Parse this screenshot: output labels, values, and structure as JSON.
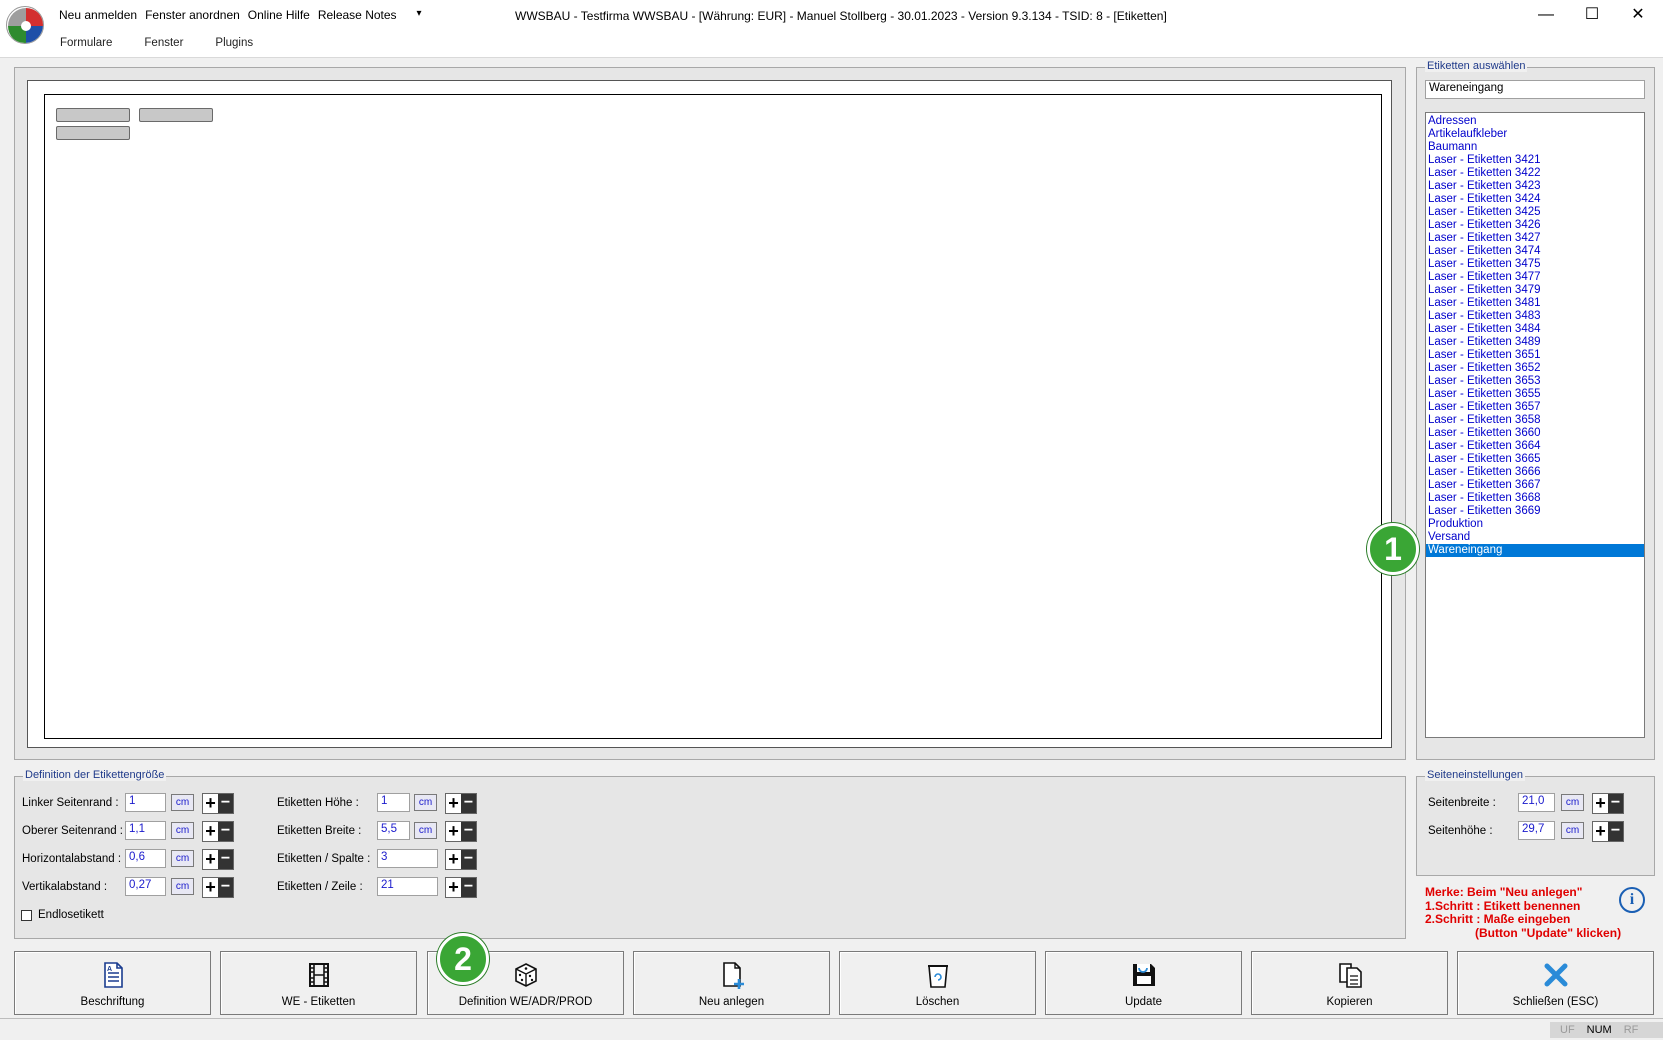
{
  "titlebar": {
    "title": "WWSBAU - Testfirma WWSBAU - [Währung: EUR] - Manuel Stollberg - 30.01.2023 - Version 9.3.134  - TSID: 8  - [Etiketten]",
    "menu": [
      "Neu anmelden",
      "Fenster anordnen",
      "Online Hilfe",
      "Release Notes"
    ],
    "dropdown_glyph": "▾",
    "submenu": [
      "Formulare",
      "Fenster",
      "Plugins"
    ],
    "minimize": "—",
    "maximize": "☐",
    "close": "✕"
  },
  "preview": {
    "label_boxes": 3
  },
  "label_select": {
    "group_title": "Etiketten auswählen",
    "current_value": "Wareneingang",
    "items": [
      "Adressen",
      "Artikelaufkleber",
      "Baumann",
      "Laser - Etiketten 3421",
      "Laser - Etiketten 3422",
      "Laser - Etiketten 3423",
      "Laser - Etiketten 3424",
      "Laser - Etiketten 3425",
      "Laser - Etiketten 3426",
      "Laser - Etiketten 3427",
      "Laser - Etiketten 3474",
      "Laser - Etiketten 3475",
      "Laser - Etiketten 3477",
      "Laser - Etiketten 3479",
      "Laser - Etiketten 3481",
      "Laser - Etiketten 3483",
      "Laser - Etiketten 3484",
      "Laser - Etiketten 3489",
      "Laser - Etiketten 3651",
      "Laser - Etiketten 3652",
      "Laser - Etiketten 3653",
      "Laser - Etiketten 3655",
      "Laser - Etiketten 3657",
      "Laser - Etiketten 3658",
      "Laser - Etiketten 3660",
      "Laser - Etiketten 3664",
      "Laser - Etiketten 3665",
      "Laser - Etiketten 3666",
      "Laser - Etiketten 3667",
      "Laser - Etiketten 3668",
      "Laser - Etiketten 3669",
      "Produktion",
      "Versand",
      "Wareneingang"
    ],
    "selected": "Wareneingang"
  },
  "size_definition": {
    "group_title": "Definition der Etikettengröße",
    "left_fields": [
      {
        "label": "Linker Seitenrand :",
        "value": "1",
        "unit": "cm"
      },
      {
        "label": "Oberer Seitenrand :",
        "value": "1,1",
        "unit": "cm"
      },
      {
        "label": "Horizontalabstand :",
        "value": "0,6",
        "unit": "cm"
      },
      {
        "label": "Vertikalabstand :",
        "value": "0,27",
        "unit": "cm"
      }
    ],
    "right_fields": [
      {
        "label": "Etiketten Höhe :",
        "value": "1",
        "unit": "cm"
      },
      {
        "label": "Etiketten Breite :",
        "value": "5,5",
        "unit": "cm"
      },
      {
        "label": "Etiketten / Spalte :",
        "value": "3"
      },
      {
        "label": "Etiketten / Zeile :",
        "value": "21"
      }
    ],
    "endless_label": "Endlosetikett",
    "endless_checked": false
  },
  "page_settings": {
    "group_title": "Seiteneinstellungen",
    "fields": [
      {
        "label": "Seitenbreite :",
        "value": "21,0",
        "unit": "cm"
      },
      {
        "label": "Seitenhöhe :",
        "value": "29,7",
        "unit": "cm"
      }
    ]
  },
  "hint": {
    "text": "Merke: Beim \"Neu anlegen\"\n1.Schritt : Etikett benennen\n2.Schritt : Maße eingeben\n               (Button \"Update\" klicken)",
    "info_glyph": "i"
  },
  "buttons": [
    {
      "label": "Beschriftung",
      "icon": "document-icon"
    },
    {
      "label": "WE - Etiketten",
      "icon": "film-icon"
    },
    {
      "label": "Definition WE/ADR/PROD",
      "icon": "dice-icon"
    },
    {
      "label": "Neu anlegen",
      "icon": "new-document-icon"
    },
    {
      "label": "Löschen",
      "icon": "trash-icon"
    },
    {
      "label": "Update",
      "icon": "save-icon"
    },
    {
      "label": "Kopieren",
      "icon": "copy-icon"
    },
    {
      "label": "Schließen (ESC)",
      "icon": "close-x-icon"
    }
  ],
  "callouts": [
    "1",
    "2"
  ],
  "statusbar": {
    "uf": "UF",
    "num": "NUM",
    "rf": "RF"
  },
  "colors": {
    "accent": "#0078d7",
    "list_text": "#0000cc",
    "hint": "#e00000",
    "callout": "#3aa635"
  }
}
